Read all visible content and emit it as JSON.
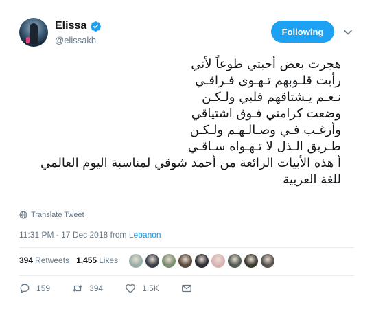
{
  "user": {
    "display_name": "Elissa",
    "handle": "@elissakh",
    "verified": true,
    "avatar_icon": "profile-photo"
  },
  "follow_label": "Following",
  "tweet_lines": [
    "هجرت بعض أحبتي طوعاً لأني",
    "رأيت قلـوبهم تـهـوى فـراقـي",
    "نـعـم يـشتاقهم قلبي ولـكـن",
    "وضعت كرامتي فـوق اشتياقي",
    "وأرغـب فـي وصـالـهـم ولـكـن",
    "طـريق الـذل لا تـهـواه سـاقـي",
    "أ هذه الأبيات الرائعة من أحمد شوقي لمناسبة اليوم العالمي",
    "للغة العربية"
  ],
  "translate_label": "Translate Tweet",
  "meta": {
    "timestamp": "11:31 PM - 17 Dec 2018",
    "from_label": "from",
    "location": "Lebanon"
  },
  "stats": {
    "retweets_count": "394",
    "retweets_label": "Retweets",
    "likes_count": "1,455",
    "likes_label": "Likes"
  },
  "likers_colors": [
    "#9ab0a6",
    "#3a3f4a",
    "#7b8e6f",
    "#5a4a3c",
    "#2c2c34",
    "#d9b3b3",
    "#4f5a52",
    "#3d3a2f",
    "#55524c"
  ],
  "actions": {
    "reply_count": "159",
    "retweet_count": "394",
    "like_count": "1.5K"
  },
  "colors": {
    "accent": "#1da1f2",
    "link": "#1b95e0",
    "muted": "#657786"
  }
}
